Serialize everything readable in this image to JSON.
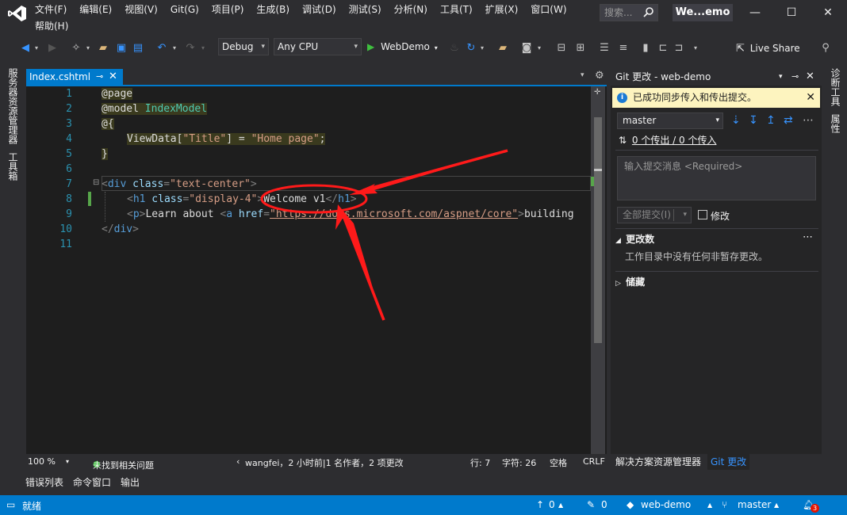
{
  "menubar": {
    "row1": [
      "文件(F)",
      "编辑(E)",
      "视图(V)",
      "Git(G)",
      "项目(P)",
      "生成(B)",
      "调试(D)",
      "测试(S)",
      "分析(N)",
      "工具(T)",
      "扩展(X)",
      "窗口(W)"
    ],
    "row2": [
      "帮助(H)"
    ],
    "search_placeholder": "搜索...",
    "solution_title": "We...emo"
  },
  "toolbar": {
    "config": "Debug",
    "platform": "Any CPU",
    "run_label": "WebDemo",
    "live_share": "Live Share"
  },
  "left_strip": {
    "server_explorer": "服务器资源管理器",
    "toolbox": "工具箱"
  },
  "right_strip": {
    "diagnostics": "诊断工具",
    "properties": "属性"
  },
  "editor": {
    "tab_label": "Index.cshtml",
    "line_numbers": [
      "1",
      "2",
      "3",
      "4",
      "5",
      "6",
      "7",
      "8",
      "9",
      "10",
      "11"
    ],
    "zoom": "100 %",
    "issues": "未找到相关问题",
    "codelens": "wangfei，2 小时前|1 名作者，2 项更改",
    "row": "行: 7",
    "col": "字符: 26",
    "ws": "空格",
    "eol": "CRLF"
  },
  "code": {
    "l1": "@page",
    "l2_kw": "@model",
    "l2_type": "IndexModel",
    "l3": "@{",
    "l4_a": "ViewData[",
    "l4_str": "\"Title\"",
    "l4_b": "] = ",
    "l4_val": "\"Home page\"",
    "l4_c": ";",
    "l5": "}",
    "l7_lt": "<",
    "l7_tag": "div",
    "l7_attr": " class",
    "l7_eq": "=",
    "l7_val": "\"text-center\"",
    "l7_gt": ">",
    "l8_tag": "h1",
    "l8_attr": " class",
    "l8_val": "\"display-4\"",
    "l8_text": "Welcome v1",
    "l8_close": "h1",
    "l9_tag": "p",
    "l9_text1": "Learn about ",
    "l9_tag2": "a",
    "l9_attr": " href",
    "l9_url": "\"https://docs.microsoft.com/aspnet/core\"",
    "l9_text2": "building",
    "l10_close": "div"
  },
  "git": {
    "title": "Git 更改 - web-demo",
    "info": "已成功同步传入和传出提交。",
    "branch": "master",
    "sync_status": "0 个传出 / 0 个传入",
    "commit_placeholder": "输入提交消息 <Required>",
    "commit_all": "全部提交(I)",
    "amend": "修改",
    "changes_header": "更改数",
    "changes_empty": "工作目录中没有任何非暂存更改。",
    "stash_header": "储藏",
    "tab_solution": "解决方案资源管理器",
    "tab_git": "Git 更改"
  },
  "bottom_tabs": [
    "错误列表",
    "命令窗口",
    "输出"
  ],
  "statusbar": {
    "ready": "就绪",
    "up": "0",
    "pencil": "0",
    "repo": "web-demo",
    "branch": "master",
    "notifications": "3"
  },
  "colors": {
    "accent": "#007acc",
    "annotation": "#ff1a1a"
  }
}
